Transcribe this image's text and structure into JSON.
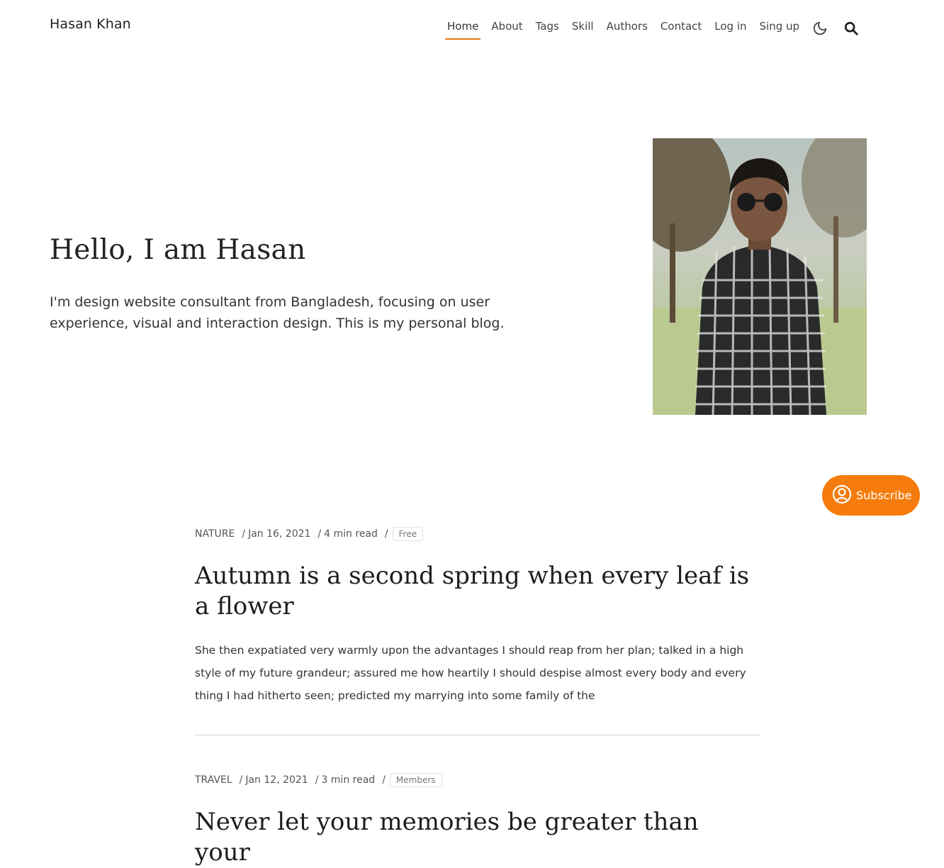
{
  "header": {
    "brand": "Hasan Khan",
    "nav": [
      {
        "label": "Home",
        "active": true
      },
      {
        "label": "About"
      },
      {
        "label": "Tags"
      },
      {
        "label": "Skill"
      },
      {
        "label": "Authors"
      },
      {
        "label": "Contact"
      },
      {
        "label": "Log in"
      },
      {
        "label": "Sing up"
      }
    ],
    "icons": [
      "moon-icon",
      "search-icon"
    ]
  },
  "hero": {
    "title": "Hello, I am Hasan",
    "description": "I'm design website consultant from Bangladesh, focusing on user experience, visual and interaction design. This is my personal blog."
  },
  "subscribe": {
    "label": "Subscribe",
    "icon": "user-circle-icon",
    "color": "#f57c0c"
  },
  "posts": [
    {
      "tag": "NATURE",
      "date": "Jan 16, 2021",
      "read_time": "4 min read",
      "access": "Free",
      "title": "Autumn is a second spring when every leaf is a flower",
      "excerpt": "She then expatiated very warmly upon the advantages I should reap from her plan; talked in a high style of my future grandeur; assured me how heartily I should despise almost every body and every thing I had hitherto seen; predicted my marrying into some family of the"
    },
    {
      "tag": "TRAVEL",
      "date": "Jan 12, 2021",
      "read_time": "3 min read",
      "access": "Members",
      "title": "Never let your memories be greater than your"
    }
  ],
  "colors": {
    "accent": "#e07b12",
    "text": "#333333"
  }
}
